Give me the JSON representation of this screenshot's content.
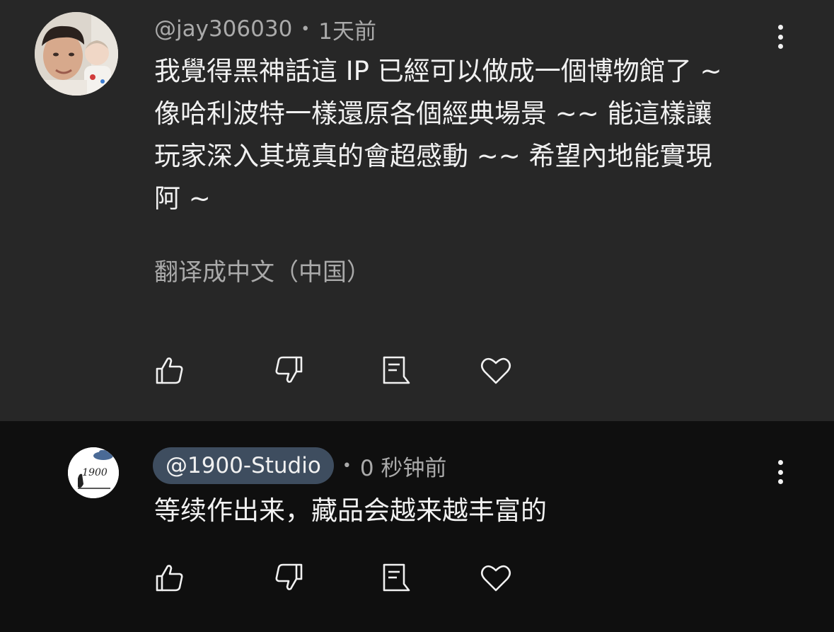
{
  "comments": [
    {
      "author": "@jay306030",
      "separator": "•",
      "time": "1天前",
      "lines": [
        "我覺得黑神話這 IP 已經可以做成一個博物館了 ~",
        "像哈利波特一樣還原各個經典場景 ~~ 能這樣讓",
        "玩家深入其境真的會超感動 ~~ 希望內地能實現",
        "阿 ~"
      ],
      "translate_label": "翻译成中文（中国）",
      "avatar_icon": "person-photo-avatar",
      "actions": {
        "like_icon": "thumb-up-icon",
        "dislike_icon": "thumb-down-icon",
        "reply_icon": "comment-reply-icon",
        "heart_icon": "heart-icon"
      },
      "more_icon": "more-vertical-icon"
    },
    {
      "author": "@1900-Studio",
      "separator": "•",
      "time": "0 秒钟前",
      "lines": [
        "等续作出来，藏品会越来越丰富的"
      ],
      "avatar_text": "1900",
      "avatar_icon": "studio-logo-avatar",
      "actions": {
        "like_icon": "thumb-up-icon",
        "dislike_icon": "thumb-down-icon",
        "reply_icon": "comment-reply-icon",
        "heart_icon": "heart-icon"
      },
      "more_icon": "more-vertical-icon"
    }
  ],
  "colors": {
    "top_comment_bg": "#272727",
    "page_bg": "#0f0f0f",
    "text_primary": "#f1f1f1",
    "text_secondary": "#aaaaaa",
    "author_pill_bg": "#3e4d5f"
  }
}
